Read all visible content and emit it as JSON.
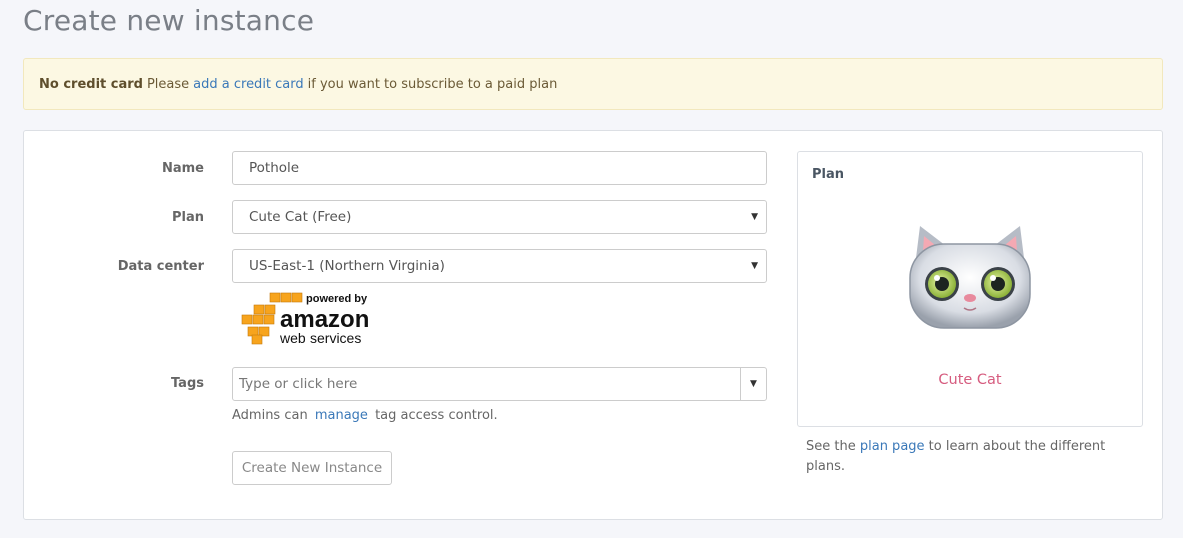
{
  "page": {
    "title": "Create new instance"
  },
  "alert": {
    "strong": "No credit card",
    "before_link": "Please",
    "link": "add a credit card",
    "after_link": "if you want to subscribe to a paid plan"
  },
  "form": {
    "name_label": "Name",
    "name_value": "Pothole",
    "plan_label": "Plan",
    "plan_value": "Cute Cat (Free)",
    "datacenter_label": "Data center",
    "datacenter_value": "US-East-1 (Northern Virginia)",
    "aws_logo": {
      "line1": "powered by",
      "line2": "amazon",
      "line3": "web",
      "line4": "services"
    },
    "tags_label": "Tags",
    "tags_placeholder": "Type or click here",
    "help_before": "Admins can",
    "help_link": "manage",
    "help_after": "tag access control.",
    "submit_label": "Create New Instance"
  },
  "plan_card": {
    "title": "Plan",
    "name": "Cute Cat",
    "note_before": "See the",
    "note_link": "plan page",
    "note_after": "to learn about the different plans."
  },
  "colors": {
    "accent_link": "#3a78b8",
    "plan_name": "#d65c7f",
    "alert_bg": "#fcf8e3",
    "aws_orange": "#f7a41d"
  },
  "icons": {
    "dropdown_caret": "caret-down-icon",
    "aws_logo": "aws-logo",
    "cat": "cat-face-icon"
  }
}
